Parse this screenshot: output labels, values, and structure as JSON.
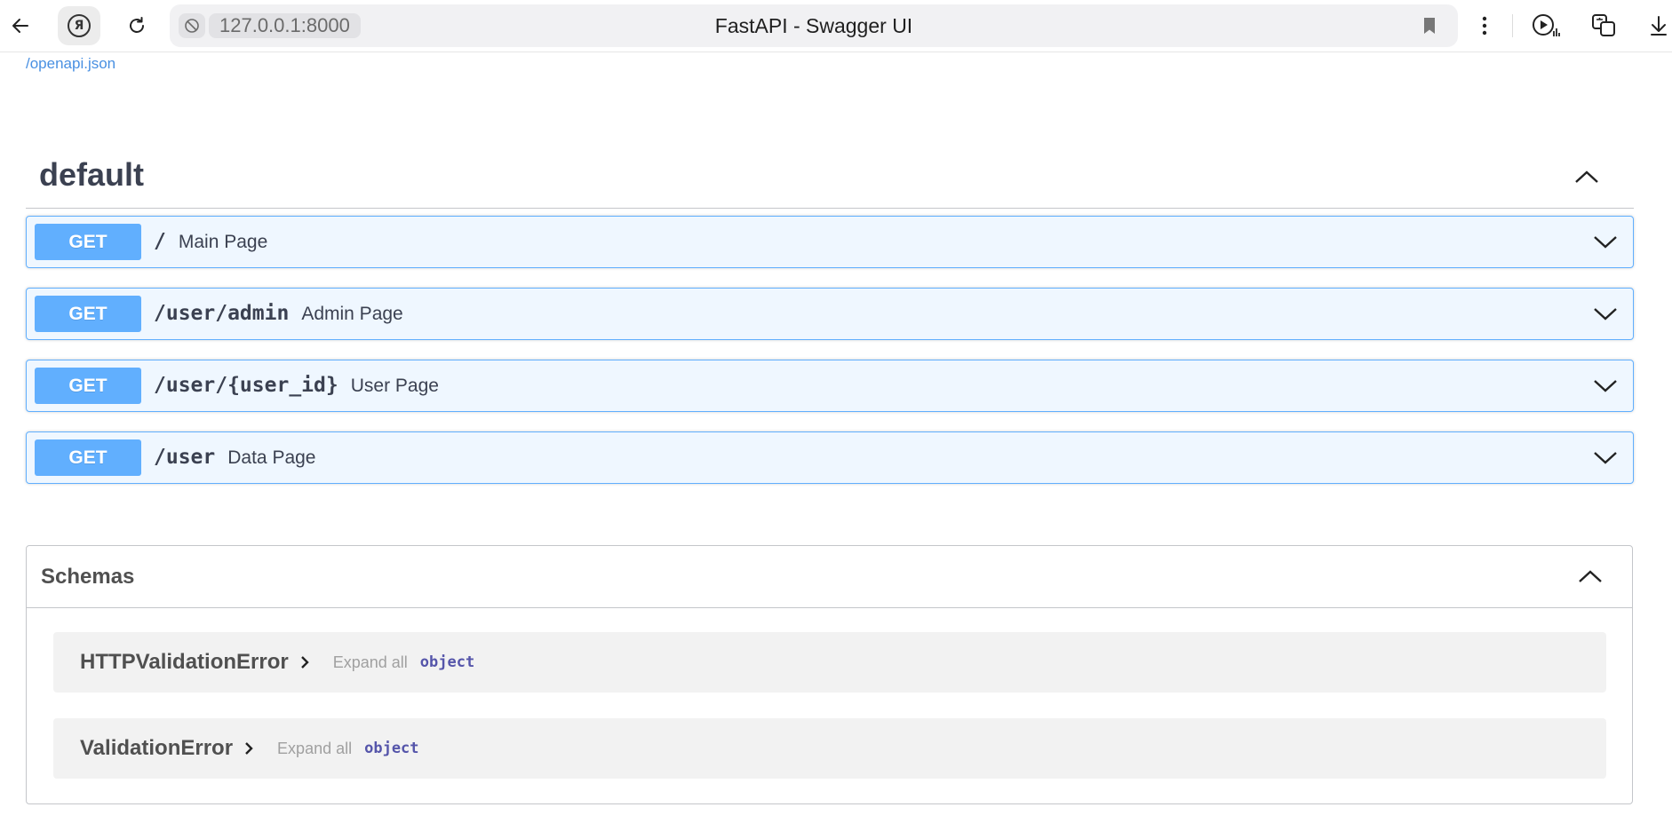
{
  "browser": {
    "url": "127.0.0.1:8000",
    "tab_title": "FastAPI - Swagger UI",
    "icons": [
      "back-arrow-icon",
      "yandex-icon",
      "reload-icon",
      "site-security-icon",
      "bookmark-icon",
      "kebab-menu-icon",
      "player-icon",
      "translate-icon",
      "download-icon"
    ]
  },
  "swagger": {
    "openapi_link": "/openapi.json",
    "tag": {
      "name": "default"
    },
    "operations": [
      {
        "method": "GET",
        "path": "/",
        "summary": "Main Page"
      },
      {
        "method": "GET",
        "path": "/user/admin",
        "summary": "Admin Page"
      },
      {
        "method": "GET",
        "path": "/user/{user_id}",
        "summary": "User Page"
      },
      {
        "method": "GET",
        "path": "/user",
        "summary": "Data Page"
      }
    ],
    "schemas": {
      "title": "Schemas",
      "models": [
        {
          "name": "HTTPValidationError",
          "expand_label": "Expand all",
          "type": "object"
        },
        {
          "name": "ValidationError",
          "expand_label": "Expand all",
          "type": "object"
        }
      ]
    }
  },
  "colors": {
    "get_method": "#61affe",
    "link": "#4990e2",
    "text": "#3b4151",
    "model_type": "#5555aa"
  }
}
